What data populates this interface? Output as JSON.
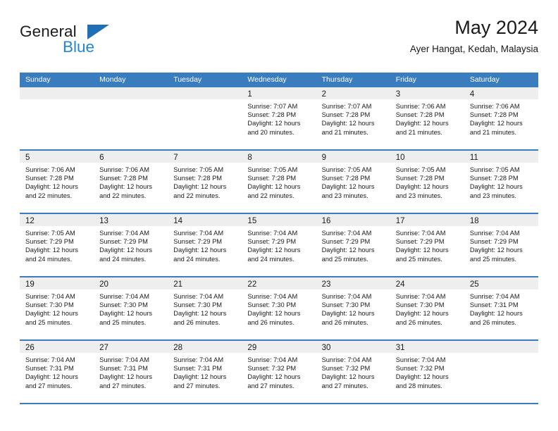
{
  "brand": {
    "name_part1": "General",
    "name_part2": "Blue",
    "triangle_color": "#1f6fb5",
    "blue_color": "#2485d4"
  },
  "header": {
    "title": "May 2024",
    "subtitle": "Ayer Hangat, Kedah, Malaysia",
    "accent_color": "#3a7dbf",
    "band_color": "#eeeeee"
  },
  "weekdays": [
    "Sunday",
    "Monday",
    "Tuesday",
    "Wednesday",
    "Thursday",
    "Friday",
    "Saturday"
  ],
  "weeks": [
    [
      {
        "day": "",
        "lines": []
      },
      {
        "day": "",
        "lines": []
      },
      {
        "day": "",
        "lines": []
      },
      {
        "day": "1",
        "lines": [
          "Sunrise: 7:07 AM",
          "Sunset: 7:28 PM",
          "Daylight: 12 hours",
          "and 20 minutes."
        ]
      },
      {
        "day": "2",
        "lines": [
          "Sunrise: 7:07 AM",
          "Sunset: 7:28 PM",
          "Daylight: 12 hours",
          "and 21 minutes."
        ]
      },
      {
        "day": "3",
        "lines": [
          "Sunrise: 7:06 AM",
          "Sunset: 7:28 PM",
          "Daylight: 12 hours",
          "and 21 minutes."
        ]
      },
      {
        "day": "4",
        "lines": [
          "Sunrise: 7:06 AM",
          "Sunset: 7:28 PM",
          "Daylight: 12 hours",
          "and 21 minutes."
        ]
      }
    ],
    [
      {
        "day": "5",
        "lines": [
          "Sunrise: 7:06 AM",
          "Sunset: 7:28 PM",
          "Daylight: 12 hours",
          "and 22 minutes."
        ]
      },
      {
        "day": "6",
        "lines": [
          "Sunrise: 7:06 AM",
          "Sunset: 7:28 PM",
          "Daylight: 12 hours",
          "and 22 minutes."
        ]
      },
      {
        "day": "7",
        "lines": [
          "Sunrise: 7:05 AM",
          "Sunset: 7:28 PM",
          "Daylight: 12 hours",
          "and 22 minutes."
        ]
      },
      {
        "day": "8",
        "lines": [
          "Sunrise: 7:05 AM",
          "Sunset: 7:28 PM",
          "Daylight: 12 hours",
          "and 22 minutes."
        ]
      },
      {
        "day": "9",
        "lines": [
          "Sunrise: 7:05 AM",
          "Sunset: 7:28 PM",
          "Daylight: 12 hours",
          "and 23 minutes."
        ]
      },
      {
        "day": "10",
        "lines": [
          "Sunrise: 7:05 AM",
          "Sunset: 7:28 PM",
          "Daylight: 12 hours",
          "and 23 minutes."
        ]
      },
      {
        "day": "11",
        "lines": [
          "Sunrise: 7:05 AM",
          "Sunset: 7:28 PM",
          "Daylight: 12 hours",
          "and 23 minutes."
        ]
      }
    ],
    [
      {
        "day": "12",
        "lines": [
          "Sunrise: 7:05 AM",
          "Sunset: 7:29 PM",
          "Daylight: 12 hours",
          "and 24 minutes."
        ]
      },
      {
        "day": "13",
        "lines": [
          "Sunrise: 7:04 AM",
          "Sunset: 7:29 PM",
          "Daylight: 12 hours",
          "and 24 minutes."
        ]
      },
      {
        "day": "14",
        "lines": [
          "Sunrise: 7:04 AM",
          "Sunset: 7:29 PM",
          "Daylight: 12 hours",
          "and 24 minutes."
        ]
      },
      {
        "day": "15",
        "lines": [
          "Sunrise: 7:04 AM",
          "Sunset: 7:29 PM",
          "Daylight: 12 hours",
          "and 24 minutes."
        ]
      },
      {
        "day": "16",
        "lines": [
          "Sunrise: 7:04 AM",
          "Sunset: 7:29 PM",
          "Daylight: 12 hours",
          "and 25 minutes."
        ]
      },
      {
        "day": "17",
        "lines": [
          "Sunrise: 7:04 AM",
          "Sunset: 7:29 PM",
          "Daylight: 12 hours",
          "and 25 minutes."
        ]
      },
      {
        "day": "18",
        "lines": [
          "Sunrise: 7:04 AM",
          "Sunset: 7:29 PM",
          "Daylight: 12 hours",
          "and 25 minutes."
        ]
      }
    ],
    [
      {
        "day": "19",
        "lines": [
          "Sunrise: 7:04 AM",
          "Sunset: 7:30 PM",
          "Daylight: 12 hours",
          "and 25 minutes."
        ]
      },
      {
        "day": "20",
        "lines": [
          "Sunrise: 7:04 AM",
          "Sunset: 7:30 PM",
          "Daylight: 12 hours",
          "and 25 minutes."
        ]
      },
      {
        "day": "21",
        "lines": [
          "Sunrise: 7:04 AM",
          "Sunset: 7:30 PM",
          "Daylight: 12 hours",
          "and 26 minutes."
        ]
      },
      {
        "day": "22",
        "lines": [
          "Sunrise: 7:04 AM",
          "Sunset: 7:30 PM",
          "Daylight: 12 hours",
          "and 26 minutes."
        ]
      },
      {
        "day": "23",
        "lines": [
          "Sunrise: 7:04 AM",
          "Sunset: 7:30 PM",
          "Daylight: 12 hours",
          "and 26 minutes."
        ]
      },
      {
        "day": "24",
        "lines": [
          "Sunrise: 7:04 AM",
          "Sunset: 7:30 PM",
          "Daylight: 12 hours",
          "and 26 minutes."
        ]
      },
      {
        "day": "25",
        "lines": [
          "Sunrise: 7:04 AM",
          "Sunset: 7:31 PM",
          "Daylight: 12 hours",
          "and 26 minutes."
        ]
      }
    ],
    [
      {
        "day": "26",
        "lines": [
          "Sunrise: 7:04 AM",
          "Sunset: 7:31 PM",
          "Daylight: 12 hours",
          "and 27 minutes."
        ]
      },
      {
        "day": "27",
        "lines": [
          "Sunrise: 7:04 AM",
          "Sunset: 7:31 PM",
          "Daylight: 12 hours",
          "and 27 minutes."
        ]
      },
      {
        "day": "28",
        "lines": [
          "Sunrise: 7:04 AM",
          "Sunset: 7:31 PM",
          "Daylight: 12 hours",
          "and 27 minutes."
        ]
      },
      {
        "day": "29",
        "lines": [
          "Sunrise: 7:04 AM",
          "Sunset: 7:32 PM",
          "Daylight: 12 hours",
          "and 27 minutes."
        ]
      },
      {
        "day": "30",
        "lines": [
          "Sunrise: 7:04 AM",
          "Sunset: 7:32 PM",
          "Daylight: 12 hours",
          "and 27 minutes."
        ]
      },
      {
        "day": "31",
        "lines": [
          "Sunrise: 7:04 AM",
          "Sunset: 7:32 PM",
          "Daylight: 12 hours",
          "and 28 minutes."
        ]
      },
      {
        "day": "",
        "lines": []
      }
    ]
  ]
}
